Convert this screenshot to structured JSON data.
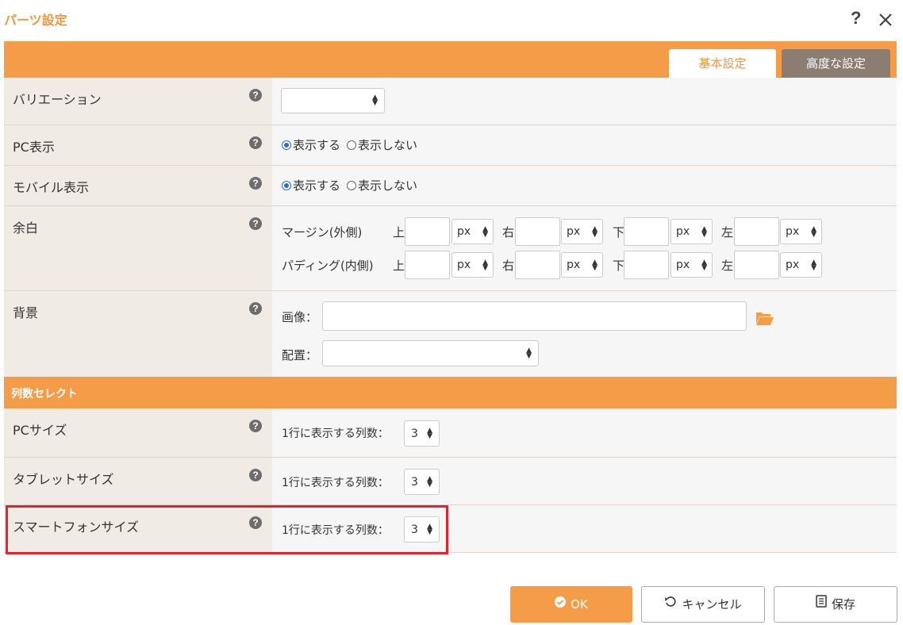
{
  "dialog": {
    "title": "パーツ設定",
    "help_glyph": "?",
    "tabs": {
      "basic": "基本設定",
      "advanced": "高度な設定"
    }
  },
  "rows": {
    "variation": {
      "label": "バリエーション",
      "value": ""
    },
    "pc_display": {
      "label": "PC表示",
      "options": [
        "表示する",
        "表示しない"
      ],
      "selected": "表示する"
    },
    "mobile_display": {
      "label": "モバイル表示",
      "options": [
        "表示する",
        "表示しない"
      ],
      "selected": "表示する"
    },
    "spacing": {
      "label": "余白",
      "margin_label": "マージン(外側)",
      "padding_label": "パディング(内側)",
      "sides": {
        "top": "上",
        "right": "右",
        "bottom": "下",
        "left": "左"
      },
      "unit": "px"
    },
    "background": {
      "label": "背景",
      "image_label": "画像：",
      "position_label": "配置：",
      "image_value": "",
      "position_value": ""
    }
  },
  "columns_section": {
    "title": "列数セレクト",
    "prompt": "1行に表示する列数：",
    "pc": {
      "label": "PCサイズ",
      "value": "3"
    },
    "tablet": {
      "label": "タブレットサイズ",
      "value": "3"
    },
    "smartphone": {
      "label": "スマートフォンサイズ",
      "value": "3"
    }
  },
  "buttons": {
    "ok": "OK",
    "cancel": "キャンセル",
    "save": "保存"
  },
  "colors": {
    "accent": "#f49c48",
    "tab_inactive": "#8b7d72",
    "highlight": "#e2232b",
    "radio": "#2a6fd6"
  }
}
